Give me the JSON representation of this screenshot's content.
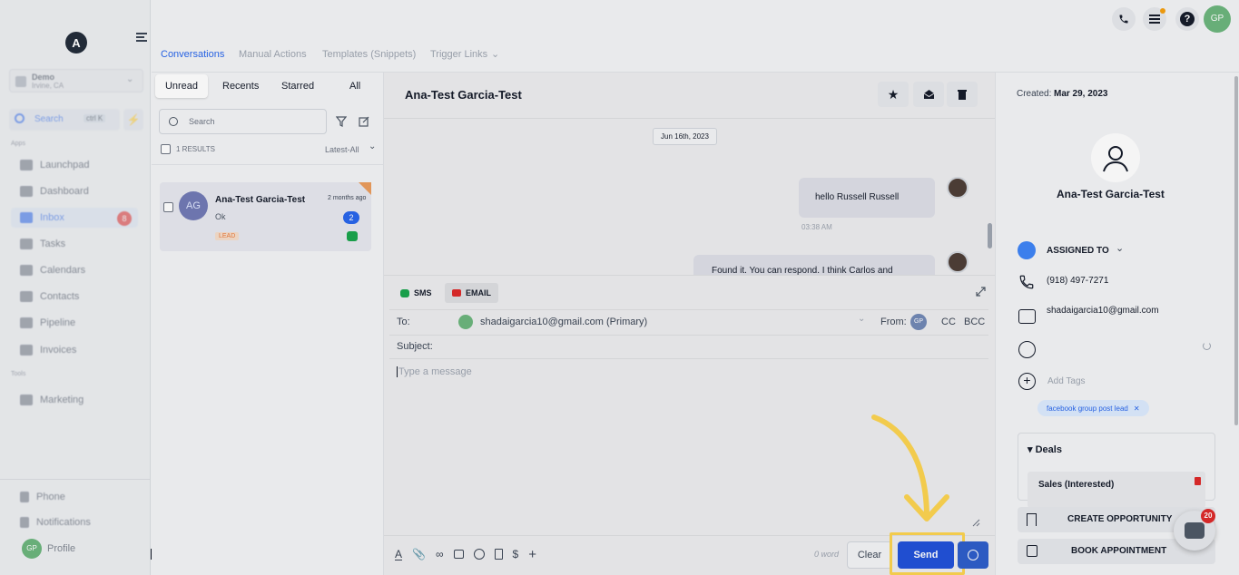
{
  "sidebar": {
    "location_name": "Demo",
    "location_sub": "Irvine, CA",
    "search_label": "Search",
    "search_shortcut": "ctrl K",
    "section_apps": "Apps",
    "items": [
      {
        "label": "Launchpad"
      },
      {
        "label": "Dashboard"
      },
      {
        "label": "Inbox",
        "badge": "8"
      },
      {
        "label": "Tasks"
      },
      {
        "label": "Calendars"
      },
      {
        "label": "Contacts"
      },
      {
        "label": "Pipeline"
      },
      {
        "label": "Invoices"
      }
    ],
    "section_tools": "Tools",
    "marketing_label": "Marketing",
    "bottom": [
      {
        "label": "Phone"
      },
      {
        "label": "Notifications"
      },
      {
        "label": "Profile"
      }
    ],
    "profile_initials": "GP"
  },
  "topbar": {
    "avatar_initials": "GP"
  },
  "tabs": [
    "Conversations",
    "Manual Actions",
    "Templates (Snippets)",
    "Trigger Links"
  ],
  "conversation_list": {
    "filters": [
      "Unread",
      "Recents",
      "Starred",
      "All"
    ],
    "search_placeholder": "Search",
    "results_label": "1 RESULTS",
    "sort_label": "Latest-All",
    "items": [
      {
        "initials": "AG",
        "name": "Ana-Test Garcia-Test",
        "time": "2 months ago",
        "preview": "Ok",
        "count": "2",
        "tag": "LEAD"
      }
    ]
  },
  "chat": {
    "contact_name": "Ana-Test Garcia-Test",
    "date_chip": "Jun 16th, 2023",
    "messages": [
      {
        "text": "hello Russell Russell",
        "time": "03:38 AM"
      },
      {
        "text": "Found it. You can respond. I think Carlos and"
      }
    ]
  },
  "composer": {
    "channels": [
      "SMS",
      "EMAIL"
    ],
    "to_label": "To:",
    "to_value": "shadaigarcia10@gmail.com (Primary)",
    "from_label": "From:",
    "from_initials": "GP",
    "cc_label": "CC",
    "bcc_label": "BCC",
    "subject_label": "Subject:",
    "message_placeholder": "Type a message",
    "word_count": "0 word",
    "clear_label": "Clear",
    "send_label": "Send"
  },
  "contact": {
    "created_label": "Created:",
    "created_date": "Mar 29, 2023",
    "name": "Ana-Test Garcia-Test",
    "assigned_label": "ASSIGNED TO",
    "phone": "(918) 497-7271",
    "email": "shadaigarcia10@gmail.com",
    "add_tags_label": "Add Tags",
    "tag": "facebook group post lead",
    "deals_label": "Deals",
    "deal_name": "Sales (Interested)",
    "create_opportunity_label": "CREATE OPPORTUNITY",
    "book_appointment_label": "BOOK APPOINTMENT",
    "chat_badge": "20"
  },
  "colors": {
    "accent": "#2563eb",
    "highlight": "#fcd34d",
    "send": "#1d4ed8"
  }
}
